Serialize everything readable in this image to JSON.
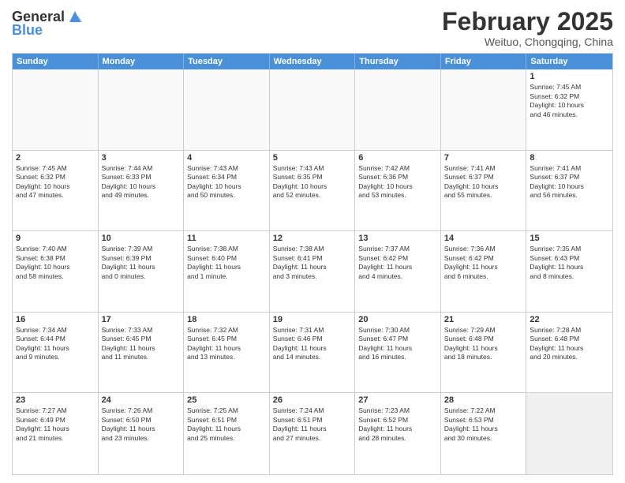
{
  "header": {
    "logo_general": "General",
    "logo_blue": "Blue",
    "title": "February 2025",
    "subtitle": "Weituo, Chongqing, China"
  },
  "calendar": {
    "days_of_week": [
      "Sunday",
      "Monday",
      "Tuesday",
      "Wednesday",
      "Thursday",
      "Friday",
      "Saturday"
    ],
    "rows": [
      [
        {
          "day": "",
          "info": "",
          "empty": true
        },
        {
          "day": "",
          "info": "",
          "empty": true
        },
        {
          "day": "",
          "info": "",
          "empty": true
        },
        {
          "day": "",
          "info": "",
          "empty": true
        },
        {
          "day": "",
          "info": "",
          "empty": true
        },
        {
          "day": "",
          "info": "",
          "empty": true
        },
        {
          "day": "1",
          "info": "Sunrise: 7:45 AM\nSunset: 6:32 PM\nDaylight: 10 hours\nand 46 minutes.",
          "empty": false
        }
      ],
      [
        {
          "day": "2",
          "info": "Sunrise: 7:45 AM\nSunset: 6:32 PM\nDaylight: 10 hours\nand 47 minutes.",
          "empty": false
        },
        {
          "day": "3",
          "info": "Sunrise: 7:44 AM\nSunset: 6:33 PM\nDaylight: 10 hours\nand 49 minutes.",
          "empty": false
        },
        {
          "day": "4",
          "info": "Sunrise: 7:43 AM\nSunset: 6:34 PM\nDaylight: 10 hours\nand 50 minutes.",
          "empty": false
        },
        {
          "day": "5",
          "info": "Sunrise: 7:43 AM\nSunset: 6:35 PM\nDaylight: 10 hours\nand 52 minutes.",
          "empty": false
        },
        {
          "day": "6",
          "info": "Sunrise: 7:42 AM\nSunset: 6:36 PM\nDaylight: 10 hours\nand 53 minutes.",
          "empty": false
        },
        {
          "day": "7",
          "info": "Sunrise: 7:41 AM\nSunset: 6:37 PM\nDaylight: 10 hours\nand 55 minutes.",
          "empty": false
        },
        {
          "day": "8",
          "info": "Sunrise: 7:41 AM\nSunset: 6:37 PM\nDaylight: 10 hours\nand 56 minutes.",
          "empty": false
        }
      ],
      [
        {
          "day": "9",
          "info": "Sunrise: 7:40 AM\nSunset: 6:38 PM\nDaylight: 10 hours\nand 58 minutes.",
          "empty": false
        },
        {
          "day": "10",
          "info": "Sunrise: 7:39 AM\nSunset: 6:39 PM\nDaylight: 11 hours\nand 0 minutes.",
          "empty": false
        },
        {
          "day": "11",
          "info": "Sunrise: 7:38 AM\nSunset: 6:40 PM\nDaylight: 11 hours\nand 1 minute.",
          "empty": false
        },
        {
          "day": "12",
          "info": "Sunrise: 7:38 AM\nSunset: 6:41 PM\nDaylight: 11 hours\nand 3 minutes.",
          "empty": false
        },
        {
          "day": "13",
          "info": "Sunrise: 7:37 AM\nSunset: 6:42 PM\nDaylight: 11 hours\nand 4 minutes.",
          "empty": false
        },
        {
          "day": "14",
          "info": "Sunrise: 7:36 AM\nSunset: 6:42 PM\nDaylight: 11 hours\nand 6 minutes.",
          "empty": false
        },
        {
          "day": "15",
          "info": "Sunrise: 7:35 AM\nSunset: 6:43 PM\nDaylight: 11 hours\nand 8 minutes.",
          "empty": false
        }
      ],
      [
        {
          "day": "16",
          "info": "Sunrise: 7:34 AM\nSunset: 6:44 PM\nDaylight: 11 hours\nand 9 minutes.",
          "empty": false
        },
        {
          "day": "17",
          "info": "Sunrise: 7:33 AM\nSunset: 6:45 PM\nDaylight: 11 hours\nand 11 minutes.",
          "empty": false
        },
        {
          "day": "18",
          "info": "Sunrise: 7:32 AM\nSunset: 6:45 PM\nDaylight: 11 hours\nand 13 minutes.",
          "empty": false
        },
        {
          "day": "19",
          "info": "Sunrise: 7:31 AM\nSunset: 6:46 PM\nDaylight: 11 hours\nand 14 minutes.",
          "empty": false
        },
        {
          "day": "20",
          "info": "Sunrise: 7:30 AM\nSunset: 6:47 PM\nDaylight: 11 hours\nand 16 minutes.",
          "empty": false
        },
        {
          "day": "21",
          "info": "Sunrise: 7:29 AM\nSunset: 6:48 PM\nDaylight: 11 hours\nand 18 minutes.",
          "empty": false
        },
        {
          "day": "22",
          "info": "Sunrise: 7:28 AM\nSunset: 6:48 PM\nDaylight: 11 hours\nand 20 minutes.",
          "empty": false
        }
      ],
      [
        {
          "day": "23",
          "info": "Sunrise: 7:27 AM\nSunset: 6:49 PM\nDaylight: 11 hours\nand 21 minutes.",
          "empty": false
        },
        {
          "day": "24",
          "info": "Sunrise: 7:26 AM\nSunset: 6:50 PM\nDaylight: 11 hours\nand 23 minutes.",
          "empty": false
        },
        {
          "day": "25",
          "info": "Sunrise: 7:25 AM\nSunset: 6:51 PM\nDaylight: 11 hours\nand 25 minutes.",
          "empty": false
        },
        {
          "day": "26",
          "info": "Sunrise: 7:24 AM\nSunset: 6:51 PM\nDaylight: 11 hours\nand 27 minutes.",
          "empty": false
        },
        {
          "day": "27",
          "info": "Sunrise: 7:23 AM\nSunset: 6:52 PM\nDaylight: 11 hours\nand 28 minutes.",
          "empty": false
        },
        {
          "day": "28",
          "info": "Sunrise: 7:22 AM\nSunset: 6:53 PM\nDaylight: 11 hours\nand 30 minutes.",
          "empty": false
        },
        {
          "day": "",
          "info": "",
          "empty": true,
          "shaded": true
        }
      ]
    ]
  }
}
